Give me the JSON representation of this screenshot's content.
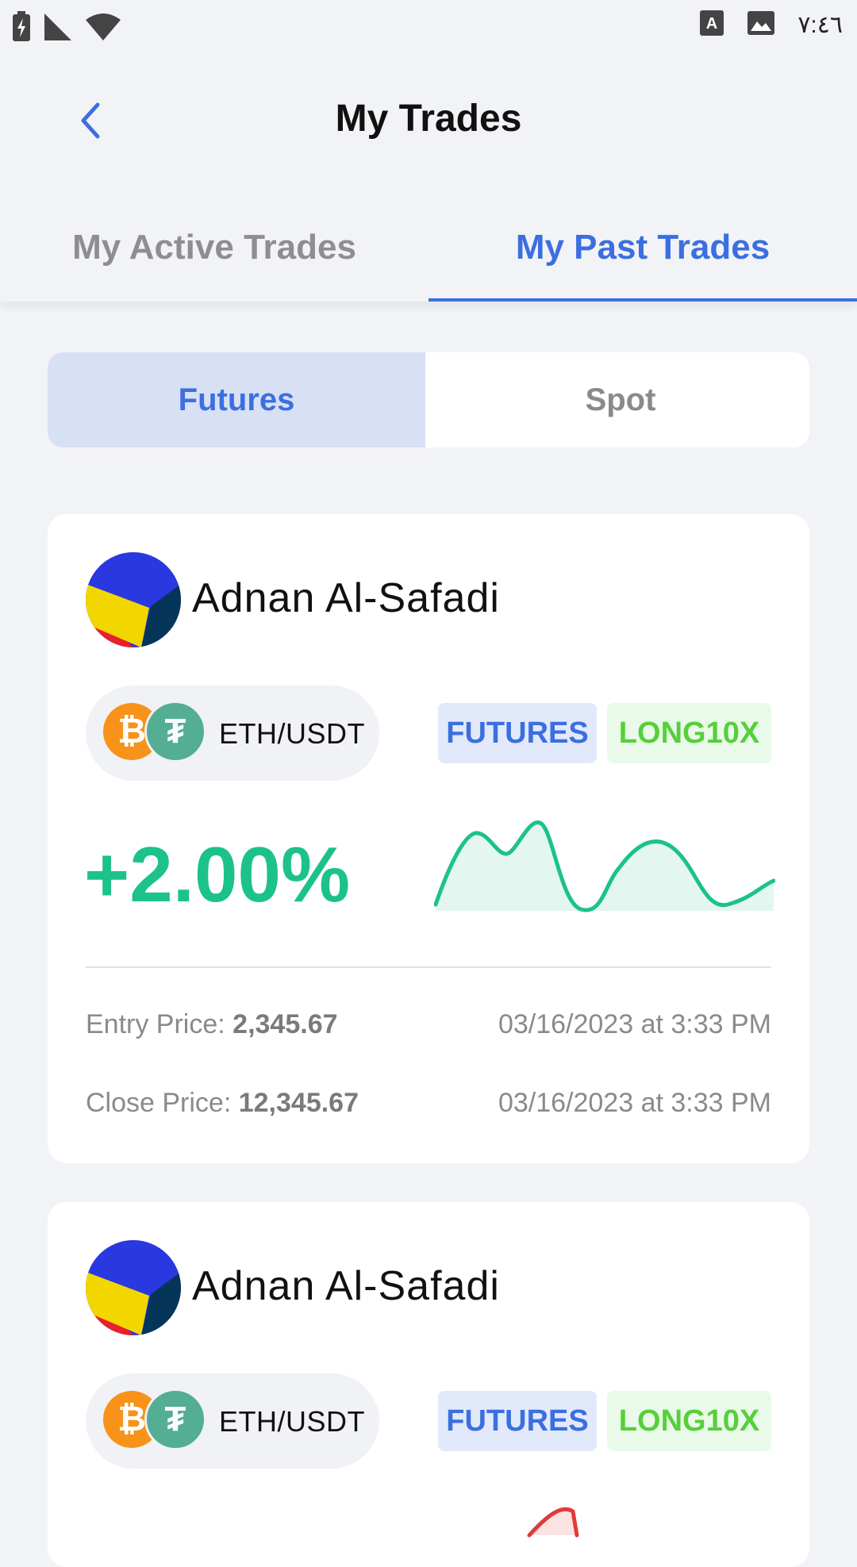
{
  "status_bar": {
    "time": "٧:٤٦",
    "icons": [
      "battery-charging-icon",
      "signal-icon",
      "wifi-icon",
      "keyboard-a-icon",
      "image-icon"
    ]
  },
  "header": {
    "title": "My Trades",
    "back_icon": "chevron-left-icon"
  },
  "tabs": {
    "active_trades": "My Active Trades",
    "past_trades": "My Past Trades",
    "selected": "My Past Trades"
  },
  "segment": {
    "futures": "Futures",
    "spot": "Spot",
    "selected": "Futures"
  },
  "trades": [
    {
      "trader_name": "Adnan Al-Safadi",
      "pair": "ETH/USDT",
      "market_tag": "FUTURES",
      "position_tag": "LONG10X",
      "pnl": "+2.00%",
      "pnl_color": "#1cc28a",
      "entry_label": "Entry Price: ",
      "entry_price": "2,345.67",
      "entry_date": "03/16/2023 at 3:33 PM",
      "close_label": "Close Price: ",
      "close_price": "12,345.67",
      "close_date": "03/16/2023 at 3:33 PM"
    },
    {
      "trader_name": "Adnan Al-Safadi",
      "pair": "ETH/USDT",
      "market_tag": "FUTURES",
      "position_tag": "LONG10X"
    }
  ],
  "colors": {
    "accent": "#3b6fe0",
    "profit": "#1cc28a",
    "loss": "#e03b3b",
    "long_tag": "#56d03a"
  }
}
